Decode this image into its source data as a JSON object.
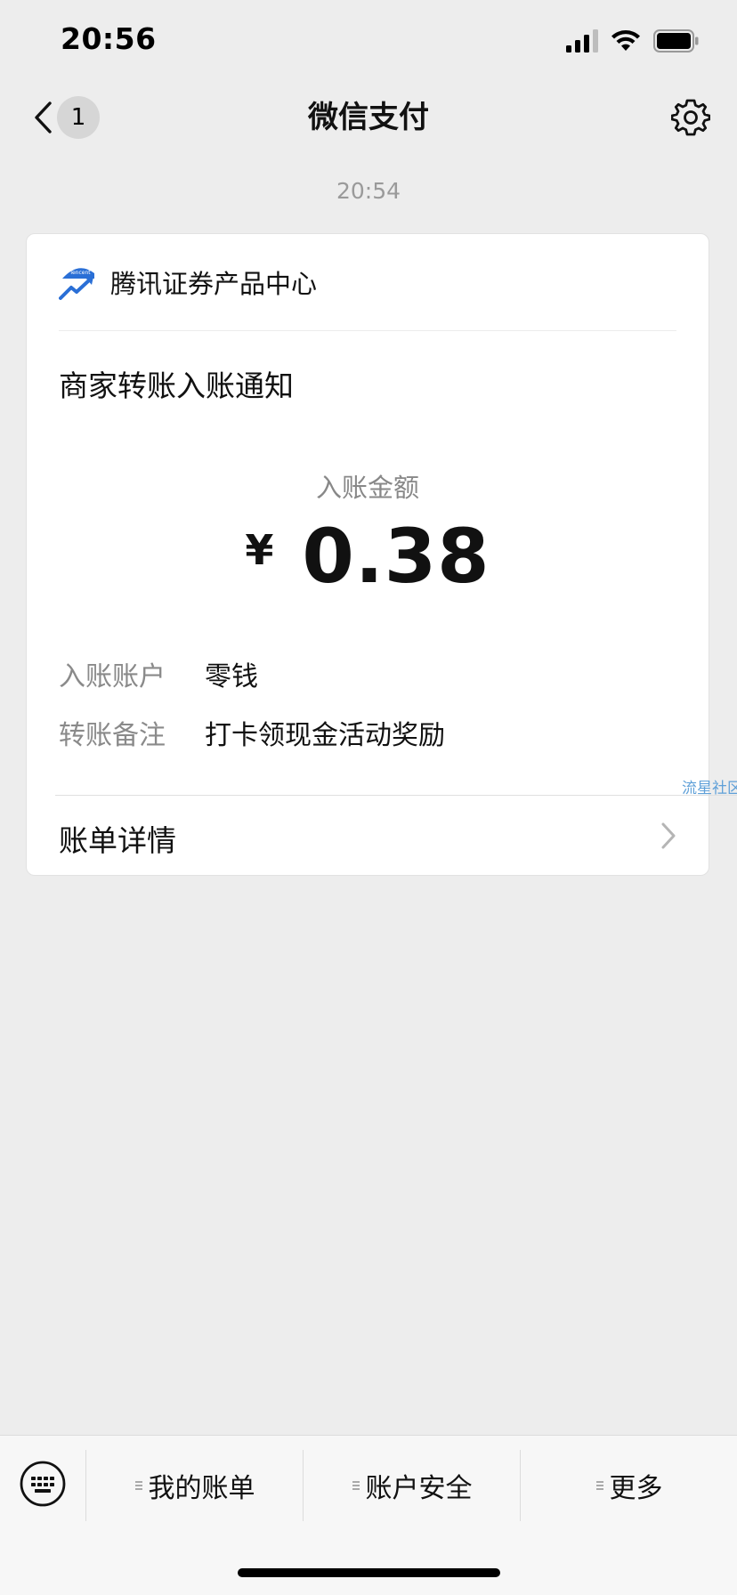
{
  "status_bar": {
    "time": "20:56"
  },
  "nav": {
    "title": "微信支付",
    "unread_count": "1"
  },
  "message": {
    "timestamp": "20:54"
  },
  "card": {
    "merchant_name": "腾讯证券产品中心",
    "logo_text": "Tencent",
    "notice_title": "商家转账入账通知",
    "amount_label": "入账金额",
    "currency_symbol": "¥",
    "amount": "0.38",
    "details": [
      {
        "label": "入账账户",
        "value": "零钱"
      },
      {
        "label": "转账备注",
        "value": "打卡领现金活动奖励"
      }
    ],
    "bill_detail_label": "账单详情",
    "watermark": "流星社区"
  },
  "bottom_menu": {
    "items": [
      {
        "label": "我的账单"
      },
      {
        "label": "账户安全"
      },
      {
        "label": "更多"
      }
    ]
  },
  "colors": {
    "background": "#ededed",
    "card": "#ffffff",
    "logo_blue": "#2a6fd6"
  }
}
